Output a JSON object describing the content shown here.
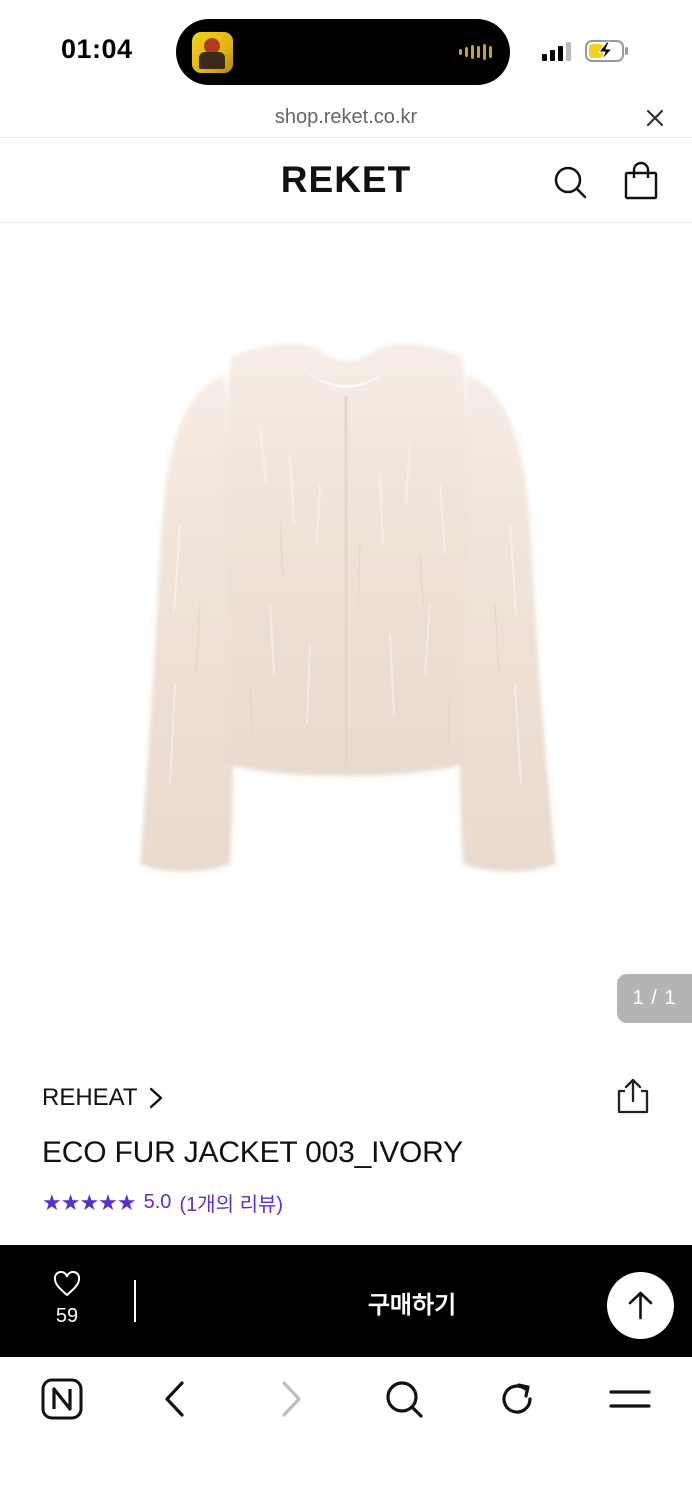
{
  "status_bar": {
    "time": "01:04"
  },
  "browser": {
    "url": "shop.reket.co.kr"
  },
  "site": {
    "logo": "REKET"
  },
  "product": {
    "image_counter": "1 / 1",
    "brand": "REHEAT",
    "title": "ECO FUR JACKET 003_IVORY",
    "stars": "★★★★★",
    "rating": "5.0",
    "review_text": "(1개의 리뷰)",
    "like_count": "59",
    "buy_label": "구매하기"
  },
  "colors": {
    "accent": "#5b2fc9",
    "buy_bar": "#000000",
    "counter_bg": "#b4b4b4",
    "fur": "#efe3d8"
  },
  "icons": {
    "url_bar": [
      "close-icon"
    ],
    "header": [
      "search-icon",
      "shopping-bag-icon"
    ],
    "product": [
      "chevron-right-icon",
      "share-icon",
      "heart-icon",
      "arrow-up-icon"
    ],
    "toolbar": [
      "naver-n-icon",
      "back-icon",
      "forward-icon",
      "search-icon",
      "reload-icon",
      "menu-icon"
    ]
  }
}
